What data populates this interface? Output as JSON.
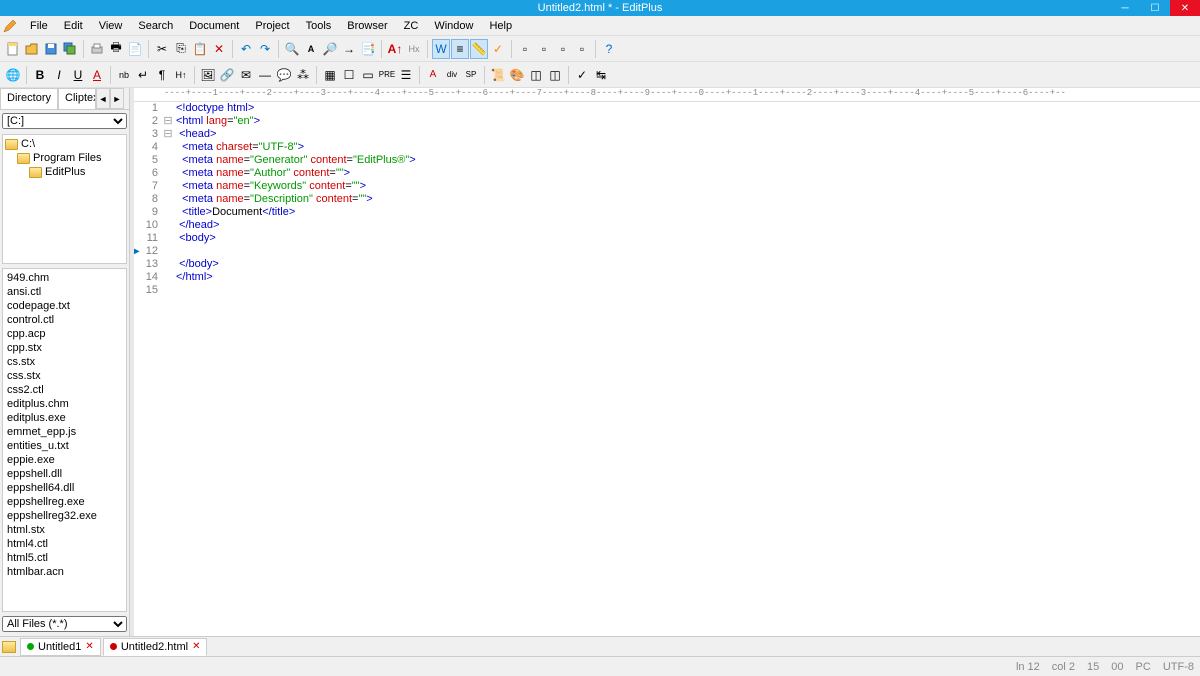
{
  "title": "Untitled2.html * - EditPlus",
  "menu": [
    "File",
    "Edit",
    "View",
    "Search",
    "Document",
    "Project",
    "Tools",
    "Browser",
    "ZC",
    "Window",
    "Help"
  ],
  "sidebar": {
    "tabs": [
      "Directory",
      "Cliptext"
    ],
    "drive": "[C:]",
    "folders": [
      {
        "name": "C:\\",
        "indent": 0
      },
      {
        "name": "Program Files",
        "indent": 1
      },
      {
        "name": "EditPlus",
        "indent": 2
      }
    ],
    "files": [
      "949.chm",
      "ansi.ctl",
      "codepage.txt",
      "control.ctl",
      "cpp.acp",
      "cpp.stx",
      "cs.stx",
      "css.stx",
      "css2.ctl",
      "editplus.chm",
      "editplus.exe",
      "emmet_epp.js",
      "entities_u.txt",
      "eppie.exe",
      "eppshell.dll",
      "eppshell64.dll",
      "eppshellreg.exe",
      "eppshellreg32.exe",
      "html.stx",
      "html4.ctl",
      "html5.ctl",
      "htmlbar.acn"
    ],
    "filter": "All Files (*.*)"
  },
  "code": {
    "lines": [
      {
        "n": 1,
        "fold": "",
        "html": "<span class='kw'>&lt;!doctype html&gt;</span>"
      },
      {
        "n": 2,
        "fold": "⊟",
        "html": "<span class='kw'>&lt;html</span> <span class='attr'>lang</span>=<span class='str'>\"en\"</span><span class='kw'>&gt;</span>"
      },
      {
        "n": 3,
        "fold": "⊟",
        "html": " <span class='kw'>&lt;head&gt;</span>"
      },
      {
        "n": 4,
        "fold": "",
        "html": "  <span class='kw'>&lt;meta</span> <span class='attr'>charset</span>=<span class='str'>\"UTF-8\"</span><span class='kw'>&gt;</span>"
      },
      {
        "n": 5,
        "fold": "",
        "html": "  <span class='kw'>&lt;meta</span> <span class='attr'>name</span>=<span class='str'>\"Generator\"</span> <span class='attr'>content</span>=<span class='str'>\"EditPlus®\"</span><span class='kw'>&gt;</span>"
      },
      {
        "n": 6,
        "fold": "",
        "html": "  <span class='kw'>&lt;meta</span> <span class='attr'>name</span>=<span class='str'>\"Author\"</span> <span class='attr'>content</span>=<span class='str'>\"\"</span><span class='kw'>&gt;</span>"
      },
      {
        "n": 7,
        "fold": "",
        "html": "  <span class='kw'>&lt;meta</span> <span class='attr'>name</span>=<span class='str'>\"Keywords\"</span> <span class='attr'>content</span>=<span class='str'>\"\"</span><span class='kw'>&gt;</span>"
      },
      {
        "n": 8,
        "fold": "",
        "html": "  <span class='kw'>&lt;meta</span> <span class='attr'>name</span>=<span class='str'>\"Description\"</span> <span class='attr'>content</span>=<span class='str'>\"\"</span><span class='kw'>&gt;</span>"
      },
      {
        "n": 9,
        "fold": "",
        "html": "  <span class='kw'>&lt;title&gt;</span>Document<span class='kw'>&lt;/title&gt;</span>"
      },
      {
        "n": 10,
        "fold": "",
        "html": " <span class='kw'>&lt;/head&gt;</span>"
      },
      {
        "n": 11,
        "fold": "",
        "html": " <span class='kw'>&lt;body&gt;</span>"
      },
      {
        "n": 12,
        "fold": "",
        "html": "",
        "cursor": true
      },
      {
        "n": 13,
        "fold": "",
        "html": " <span class='kw'>&lt;/body&gt;</span>"
      },
      {
        "n": 14,
        "fold": "",
        "html": "<span class='kw'>&lt;/html&gt;</span>"
      },
      {
        "n": 15,
        "fold": "",
        "html": ""
      }
    ]
  },
  "tabs": [
    {
      "name": "Untitled1",
      "active": false,
      "modified": false
    },
    {
      "name": "Untitled2.html",
      "active": true,
      "modified": true
    }
  ],
  "status": {
    "left": "",
    "ln": "ln 12",
    "col": "col 2",
    "lines": "15",
    "chars": "00",
    "mode": "PC",
    "enc": "UTF-8"
  },
  "ruler": "----+----1----+----2----+----3----+----4----+----5----+----6----+----7----+----8----+----9----+----0----+----1----+----2----+----3----+----4----+----5----+----6----+--"
}
